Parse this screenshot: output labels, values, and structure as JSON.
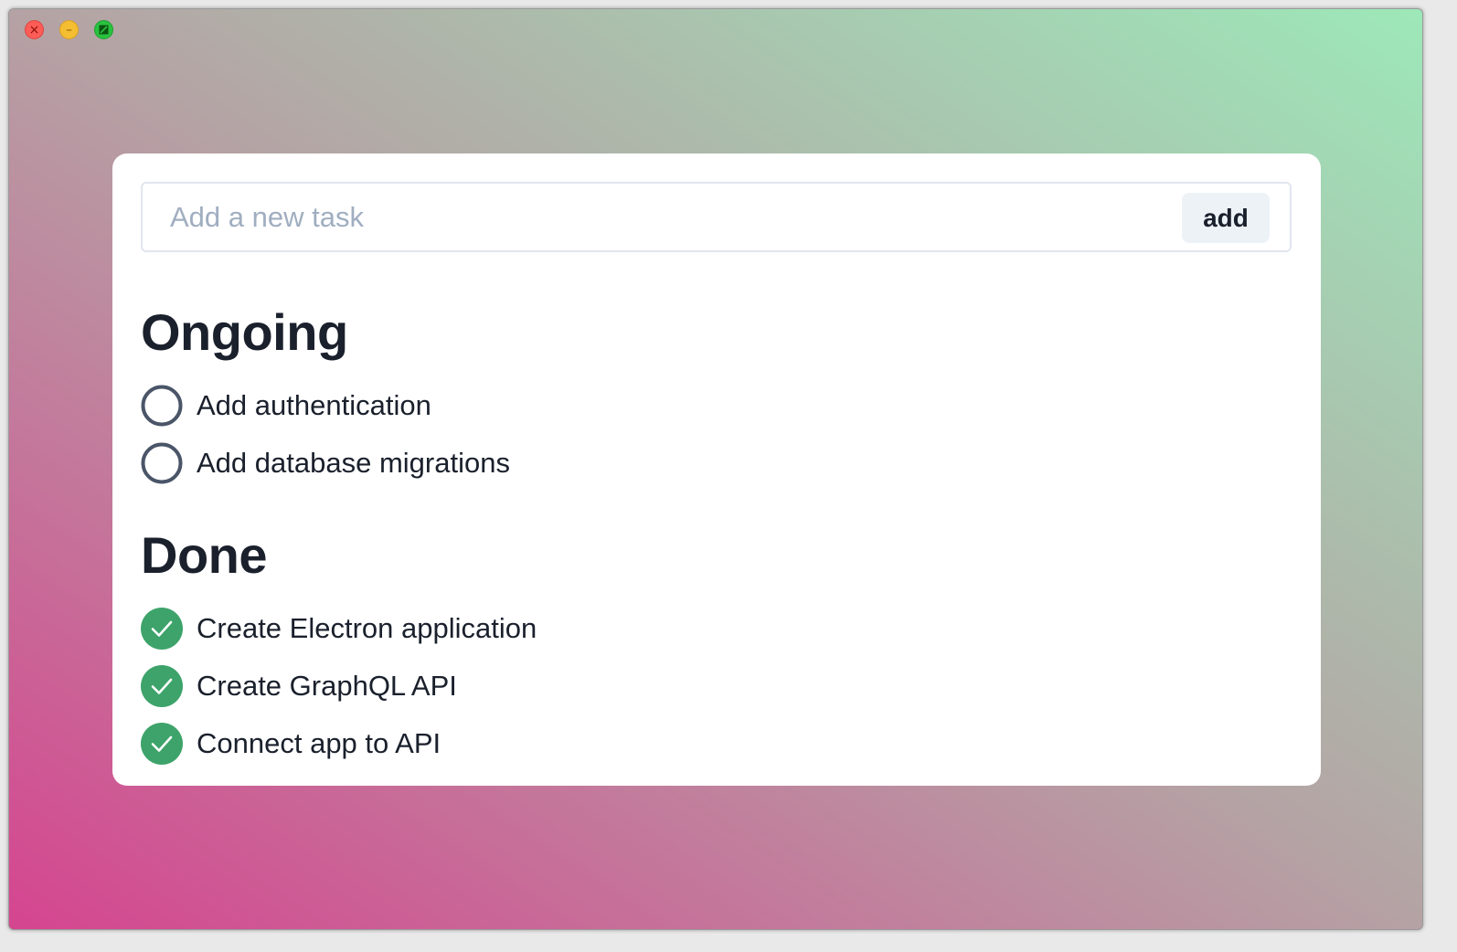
{
  "window": {
    "controls": {
      "close_icon": "close-icon",
      "minimize_icon": "minimize-icon",
      "maximize_icon": "maximize-icon"
    },
    "background_colors": [
      "#d54590",
      "#b5a2a4",
      "#9de8b9"
    ]
  },
  "new_task": {
    "placeholder": "Add a new task",
    "value": "",
    "add_label": "add"
  },
  "ongoing": {
    "title": "Ongoing",
    "items": [
      {
        "label": "Add authentication",
        "done": false
      },
      {
        "label": "Add database migrations",
        "done": false
      }
    ]
  },
  "done": {
    "title": "Done",
    "items": [
      {
        "label": "Create Electron application",
        "done": true
      },
      {
        "label": "Create GraphQL API",
        "done": true
      },
      {
        "label": "Connect app to API",
        "done": true
      }
    ]
  },
  "colors": {
    "text": "#1a202c",
    "placeholder": "#a0aec0",
    "unchecked_ring": "#4a5568",
    "checked_fill": "#3da36a",
    "button_bg": "#edf2f7"
  }
}
